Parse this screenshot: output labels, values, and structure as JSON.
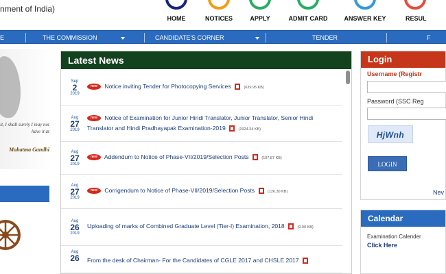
{
  "header": {
    "org_subtitle": "nment of India)",
    "quicknav": [
      {
        "label": "HOME",
        "color": "#1a237e"
      },
      {
        "label": "NOTICES",
        "color": "#f39c12"
      },
      {
        "label": "APPLY",
        "color": "#27ae60"
      },
      {
        "label": "ADMIT CARD",
        "color": "#27ae60"
      },
      {
        "label": "ANSWER KEY",
        "color": "#3498db"
      },
      {
        "label": "RESUL",
        "color": "#e74c3c"
      }
    ]
  },
  "nav": {
    "item_e": "E",
    "commission": "THE COMMISSION",
    "candidates": "CANDIDATE'S CORNER",
    "tender": "TENDER",
    "item_last": "F"
  },
  "left": {
    "quote": "it, I shall surely I may not have it at",
    "author": "Mahatma Gandhi"
  },
  "news": {
    "title": "Latest News",
    "new_badge": "new",
    "items": [
      {
        "mon": "Sep",
        "day": "2",
        "year": "2019",
        "is_new": true,
        "text": "Notice inviting Tender for Photocopying Services",
        "size": "(639.95 KB)"
      },
      {
        "mon": "Aug",
        "day": "27",
        "year": "2019",
        "is_new": true,
        "text": "Notice of Examination for Junior Hindi Translator, Junior Translator, Senior Hindi Translator and Hindi Pradhayapak Examination-2019",
        "size": "(1924.34 KB)"
      },
      {
        "mon": "Aug",
        "day": "27",
        "year": "2019",
        "is_new": true,
        "text": "Addendum to Notice of Phase-VII/2019/Selection Posts",
        "size": "(107.87 KB)"
      },
      {
        "mon": "Aug",
        "day": "27",
        "year": "2019",
        "is_new": true,
        "text": "Corrigendum to Notice of Phase-VII/2019/Selection Posts",
        "size": "(126.30 KB)"
      },
      {
        "mon": "Aug",
        "day": "26",
        "year": "2019",
        "is_new": false,
        "text": "Uploading of marks of Combined Graduate Level (Tier-I) Examination, 2018",
        "size": "(0.00 KB)"
      },
      {
        "mon": "Aug",
        "day": "26",
        "year": "",
        "is_new": false,
        "text": "From the desk of Chairman- For the Candidates of CGLE 2017 and CHSLE 2017",
        "size": ""
      }
    ]
  },
  "login": {
    "title": "Login",
    "username_label": "Username (Registr",
    "password_label": "Password (SSC Reg",
    "captcha": "HjWnh",
    "button": "LOGIN",
    "new_user": "Nev"
  },
  "calendar": {
    "title": "Calendar",
    "label": "Examination Calender",
    "link": "Click Here"
  }
}
